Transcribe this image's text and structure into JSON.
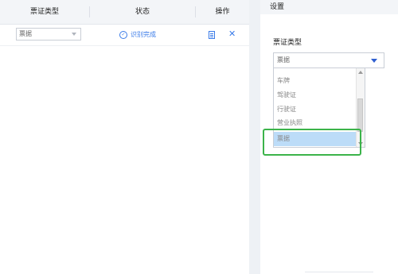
{
  "table": {
    "columns": [
      "票证类型",
      "状态",
      "操作"
    ],
    "row": {
      "type_value": "票据",
      "status": "识别完成"
    }
  },
  "panel": {
    "title": "设置",
    "field_label": "票证类型",
    "select_value": "票据",
    "options": [
      {
        "label": "车牌",
        "selected": false
      },
      {
        "label": "驾驶证",
        "selected": false
      },
      {
        "label": "行驶证",
        "selected": false
      },
      {
        "label": "营业执照",
        "selected": false
      },
      {
        "label": "票据",
        "selected": true
      }
    ]
  },
  "colors": {
    "accent": "#3a7be8",
    "selected_option": "#bcdcf8",
    "highlight_box": "#3bb34a"
  }
}
